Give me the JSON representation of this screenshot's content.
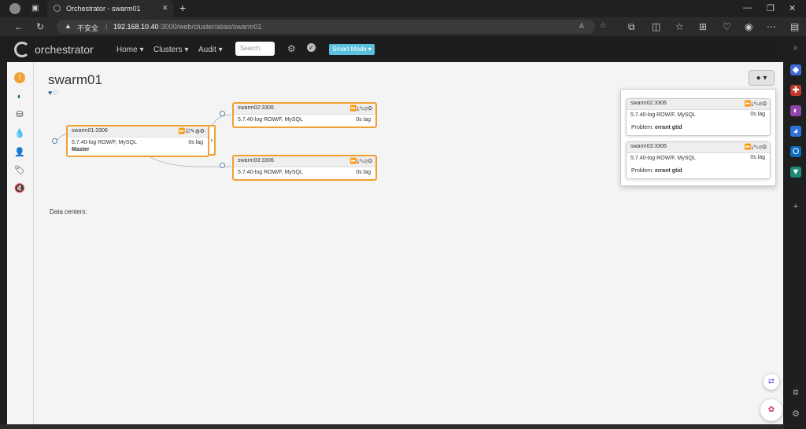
{
  "browser": {
    "tab_title": "Orchestrator - swarm01",
    "new_tab": "+",
    "insecure_label": "不安全",
    "url_host": "192.168.10.40",
    "url_path": ":3000/web/cluster/alias/swarm01"
  },
  "app": {
    "brand": "orchestrator",
    "menu": [
      "Home ▾",
      "Clusters ▾",
      "Audit ▾"
    ],
    "search_placeholder": "Search",
    "smart_mode": "Smart Mode ▾"
  },
  "cluster": {
    "title": "swarm01",
    "hearts": "♥♡",
    "data_centers_label": "Data centers:"
  },
  "nodes": [
    {
      "name": "swarm01:3306",
      "version": "5.7.40-log ROW/F, MySQL",
      "lag": "0s lag",
      "role": "Master",
      "icons": "⏩☑✎◍⚙"
    },
    {
      "name": "swarm02:3306",
      "version": "5.7.40-log ROW/F, MySQL",
      "lag": "0s lag",
      "icons": "⏩⤓✎⊘⚙"
    },
    {
      "name": "swarm03:3306",
      "version": "5.7.40-log ROW/F, MySQL",
      "lag": "0s lag",
      "icons": "⏩⤓✎⊘⚙"
    }
  ],
  "problems": [
    {
      "name": "swarm02:3306",
      "version": "5.7.40-log ROW/F, MySQL",
      "lag": "0s lag",
      "problem_label": "Problem:",
      "problem": "errant gtid",
      "icons": "⏩⤓✎⊘⚙"
    },
    {
      "name": "swarm03:3306",
      "version": "5.7.40-log ROW/F, MySQL",
      "lag": "0s lag",
      "problem_label": "Problem:",
      "problem": "errant gtid",
      "icons": "⏩⤓✎⊘⚙"
    }
  ],
  "colors": {
    "accent": "#f0a030",
    "smart_mode": "#5bc0de",
    "link_dot": "#4a7fb5"
  }
}
